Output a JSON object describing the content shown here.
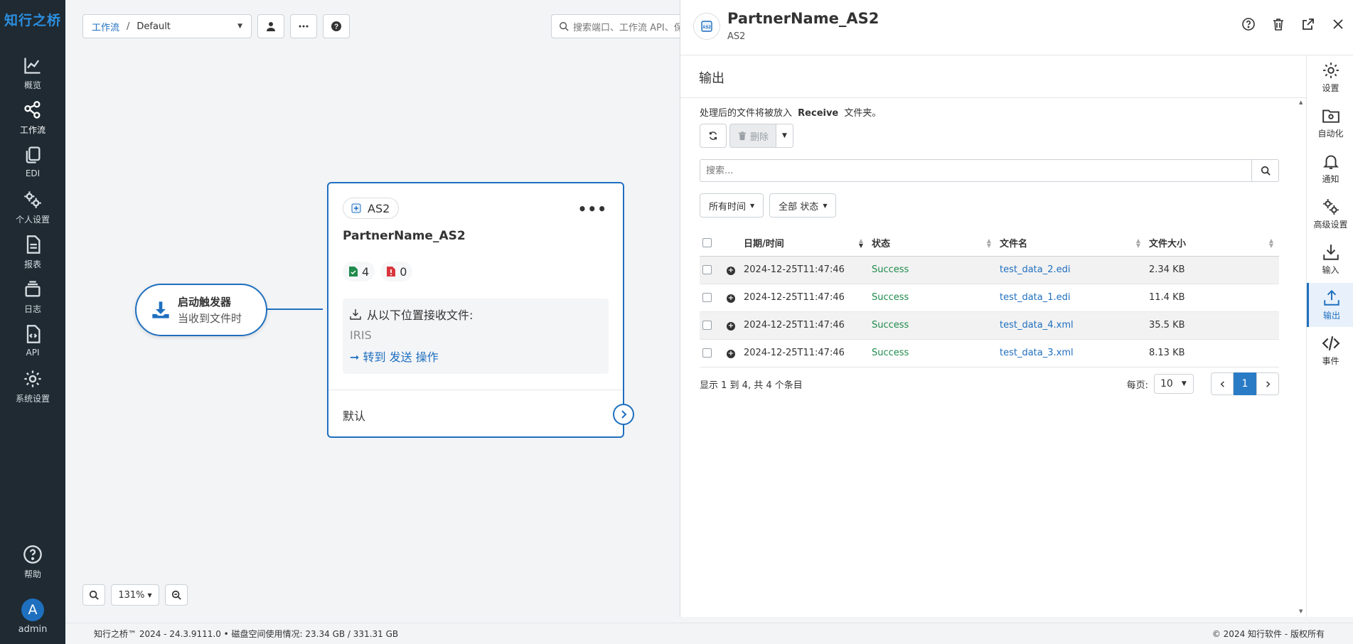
{
  "brand": "知行之桥",
  "nav": {
    "items": [
      {
        "label": "概览",
        "icon": "chart-line-icon"
      },
      {
        "label": "工作流",
        "icon": "share-nodes-icon"
      },
      {
        "label": "EDI",
        "icon": "copy-icon"
      },
      {
        "label": "个人设置",
        "icon": "gears-icon"
      },
      {
        "label": "报表",
        "icon": "file-lines-icon"
      },
      {
        "label": "日志",
        "icon": "layers-icon"
      },
      {
        "label": "API",
        "icon": "file-code-icon"
      },
      {
        "label": "系统设置",
        "icon": "gear-icon"
      },
      {
        "label": "帮助",
        "icon": "question-circle-icon"
      }
    ],
    "user": {
      "initial": "A",
      "name": "admin"
    }
  },
  "canvas": {
    "breadcrumb": {
      "link": "工作流",
      "separator": "/",
      "current": "Default"
    },
    "search_placeholder": "搜索端口、工作流 API、保",
    "trigger": {
      "title": "启动触发器",
      "subtitle": "当收到文件时"
    },
    "card": {
      "chip_label": "AS2",
      "title": "PartnerName_AS2",
      "success_count": "4",
      "error_count": "0",
      "receive_label": "从以下位置接收文件:",
      "receive_source": "IRIS",
      "goto_link": "➞ 转到 发送 操作",
      "default_label": "默认"
    },
    "zoom_level": "131%"
  },
  "footer": {
    "left": "知行之桥™ 2024 - 24.3.9111.0  •  磁盘空间使用情况:  23.34 GB / 331.31 GB",
    "right": "© 2024 知行软件 - 版权所有"
  },
  "panel": {
    "title": "PartnerName_AS2",
    "subtitle": "AS2",
    "section_title": "输出",
    "info_prefix": "处理后的文件将被放入",
    "info_folder": "Receive",
    "info_suffix": "文件夹。",
    "delete_label": "删除",
    "search_placeholder": "搜索...",
    "filter_time": "所有时间",
    "filter_status": "全部 状态",
    "columns": [
      "日期/时间",
      "状态",
      "文件名",
      "文件大小"
    ],
    "rows": [
      {
        "datetime": "2024-12-25T11:47:46",
        "status": "Success",
        "filename": "test_data_2.edi",
        "size": "2.34 KB"
      },
      {
        "datetime": "2024-12-25T11:47:46",
        "status": "Success",
        "filename": "test_data_1.edi",
        "size": "11.4 KB"
      },
      {
        "datetime": "2024-12-25T11:47:46",
        "status": "Success",
        "filename": "test_data_4.xml",
        "size": "35.5 KB"
      },
      {
        "datetime": "2024-12-25T11:47:46",
        "status": "Success",
        "filename": "test_data_3.xml",
        "size": "8.13 KB"
      }
    ],
    "pager_summary": "显示 1 到 4, 共 4 个条目",
    "per_page_label": "每页:",
    "per_page_value": "10",
    "current_page": "1",
    "tabs": [
      {
        "label": "设置",
        "icon": "gear-icon"
      },
      {
        "label": "自动化",
        "icon": "folder-gear-icon"
      },
      {
        "label": "通知",
        "icon": "bell-icon"
      },
      {
        "label": "高级设置",
        "icon": "gears-icon"
      },
      {
        "label": "输入",
        "icon": "download-icon"
      },
      {
        "label": "输出",
        "icon": "upload-icon"
      },
      {
        "label": "事件",
        "icon": "code-icon"
      }
    ]
  },
  "colors": {
    "accent": "#1f6fbf",
    "nav_bg": "#1f2a32",
    "success": "#1f8b4c",
    "error": "#d9363e"
  }
}
